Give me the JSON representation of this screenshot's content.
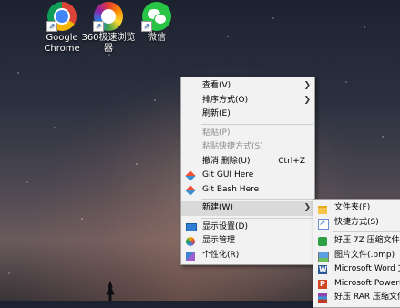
{
  "desktop": {
    "icons": [
      {
        "label": "Google Chrome"
      },
      {
        "label": "360极速浏览器"
      },
      {
        "label": "微信"
      }
    ]
  },
  "context_menu": {
    "items": [
      {
        "label": "查看(V)"
      },
      {
        "label": "排序方式(O)"
      },
      {
        "label": "刷新(E)"
      },
      {
        "label": "粘贴(P)"
      },
      {
        "label": "粘贴快捷方式(S)"
      },
      {
        "label": "撤消 删除(U)",
        "shortcut": "Ctrl+Z"
      },
      {
        "label": "Git GUI Here"
      },
      {
        "label": "Git Bash Here"
      },
      {
        "label": "新建(W)"
      },
      {
        "label": "显示设置(D)"
      },
      {
        "label": "显示管理"
      },
      {
        "label": "个性化(R)"
      }
    ]
  },
  "submenu_new": {
    "items": [
      {
        "label": "文件夹(F)"
      },
      {
        "label": "快捷方式(S)"
      },
      {
        "label": "好压 7Z 压缩文件"
      },
      {
        "label": "图片文件(.bmp)"
      },
      {
        "label": "Microsoft Word 文"
      },
      {
        "label": "Microsoft PowerP"
      },
      {
        "label": "好压 RAR 压缩文件"
      }
    ]
  }
}
